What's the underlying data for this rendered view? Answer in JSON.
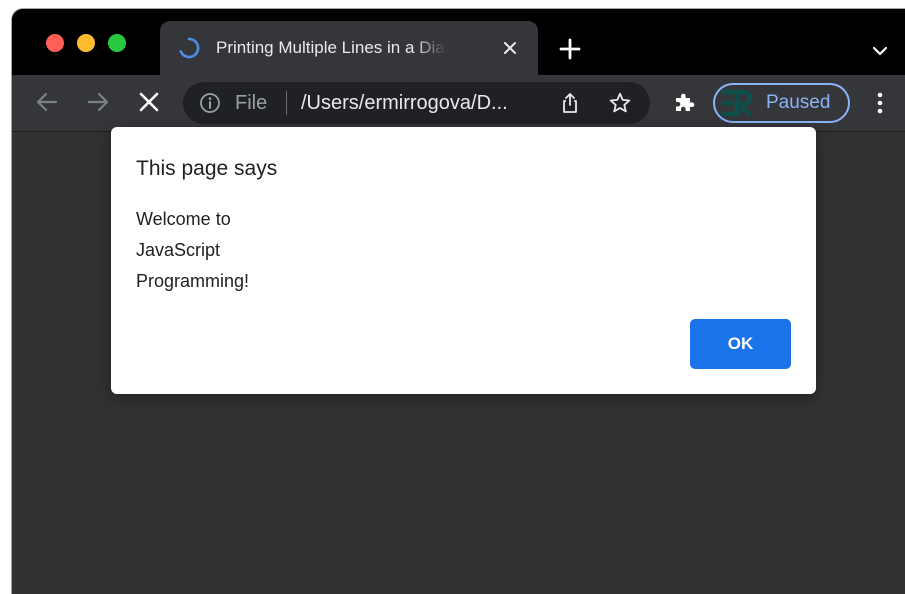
{
  "colors": {
    "accent": "#1a73e8",
    "profile_outline": "#8ab4f8",
    "traffic_close": "#ff5f57",
    "traffic_minimize": "#febc2e",
    "traffic_maximize": "#28c840"
  },
  "tab": {
    "title": "Printing Multiple Lines in a Dialog Box",
    "state": "loading",
    "icons": [
      "loading-spinner-icon",
      "close-icon"
    ]
  },
  "tabstrip": {
    "icons": [
      "plus-icon",
      "chevron-down-icon"
    ]
  },
  "toolbar": {
    "icons": [
      "back-arrow-icon",
      "forward-arrow-icon",
      "stop-icon",
      "puzzle-icon",
      "more-vert-icon"
    ],
    "omnibox": {
      "scheme": "File",
      "url": "/Users/ermirrogova/D...",
      "icons": [
        "info-icon",
        "share-icon",
        "star-icon"
      ]
    },
    "profile": {
      "label": "Paused",
      "icon": "er-avatar-icon"
    }
  },
  "dialog": {
    "heading": "This page says",
    "message_lines": [
      "Welcome to",
      "JavaScript",
      "Programming!"
    ],
    "ok_label": "OK"
  }
}
